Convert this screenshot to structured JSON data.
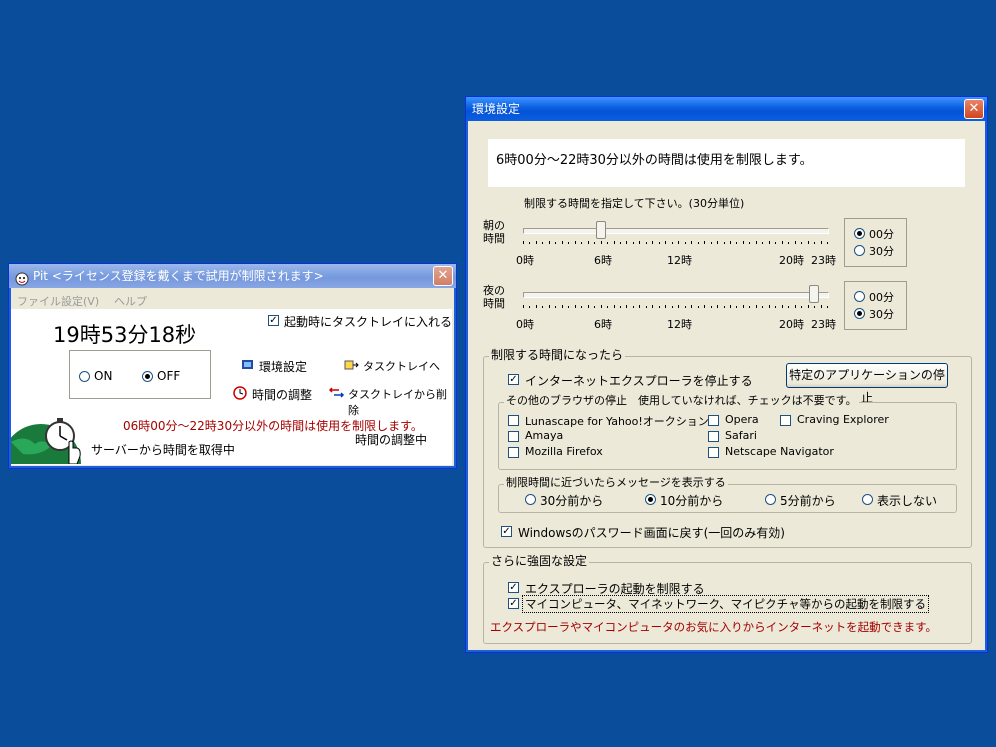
{
  "main_window": {
    "title": "Pit <ライセンス登録を戴くまで試用が制限されます>",
    "menu": [
      "ファイル",
      "設定(V)",
      "ヘルプ"
    ],
    "clock": "19時53分18秒",
    "startup_tray": {
      "label": "起動時にタスクトレイに入れる",
      "checked": true
    },
    "on_label": "ON",
    "off_label": "OFF",
    "selected": "OFF",
    "buttons": {
      "settings": "環境設定",
      "to_tray": "タスクトレイへ",
      "time_adjust": "時間の調整",
      "remove_tray": "タスクトレイから削除"
    },
    "restriction_msg": "06時00分～22時30分以外の時間は使用を制限します。",
    "adjust_status": "時間の調整中",
    "server_status": "サーバーから時間を取得中"
  },
  "settings_window": {
    "title": "環境設定",
    "summary": "6時00分～22時30分以外の時間は使用を制限します。",
    "instruction": "制限する時間を指定して下さい。(30分単位)",
    "morning": {
      "label1": "朝の",
      "label2": "時間",
      "ticks": [
        "0時",
        "6時",
        "12時",
        "20時",
        "23時"
      ],
      "value_hour": 6,
      "opt_00": "00分",
      "opt_30": "30分",
      "selected_minutes": "00分"
    },
    "night": {
      "label1": "夜の",
      "label2": "時間",
      "ticks": [
        "0時",
        "6時",
        "12時",
        "20時",
        "23時"
      ],
      "value_hour": 22.5,
      "opt_00": "00分",
      "opt_30": "30分",
      "selected_minutes": "30分"
    },
    "when_limited": {
      "title": "制限する時間になったら",
      "stop_ie": {
        "label": "インターネットエクスプローラを停止する",
        "checked": true
      },
      "stop_app_button": "特定のアプリケーションの停止",
      "other_browsers": {
        "title": "その他のブラウザの停止　使用していなければ、チェックは不要です。",
        "items": [
          {
            "label": "Lunascape for Yahoo!オークション",
            "checked": false
          },
          {
            "label": "Opera",
            "checked": false
          },
          {
            "label": "Craving Explorer",
            "checked": false
          },
          {
            "label": "Amaya",
            "checked": false
          },
          {
            "label": "Safari",
            "checked": false
          },
          {
            "label": "Mozilla Firefox",
            "checked": false
          },
          {
            "label": "Netscape Navigator",
            "checked": false
          }
        ]
      },
      "message": {
        "title": "制限時間に近づいたらメッセージを表示する",
        "options": [
          "30分前から",
          "10分前から",
          "5分前から",
          "表示しない"
        ],
        "selected": "10分前から"
      },
      "windows_password": {
        "label": "Windowsのパスワード画面に戻す(一回のみ有効)",
        "checked": true
      }
    },
    "stronger": {
      "title": "さらに強固な設定",
      "restrict_explorer": {
        "label": "エクスプローラの起動を制限する",
        "checked": true
      },
      "restrict_mycomputer": {
        "label": "マイコンピュータ、マイネットワーク、マイピクチャ等からの起動を制限する",
        "checked": true
      },
      "note": "エクスプローラやマイコンピュータのお気に入りからインターネットを起動できます。"
    }
  },
  "colors": {
    "desktop": "#0a4e9b",
    "titlebar": "#0a5fe0",
    "note_red": "#a50000"
  }
}
